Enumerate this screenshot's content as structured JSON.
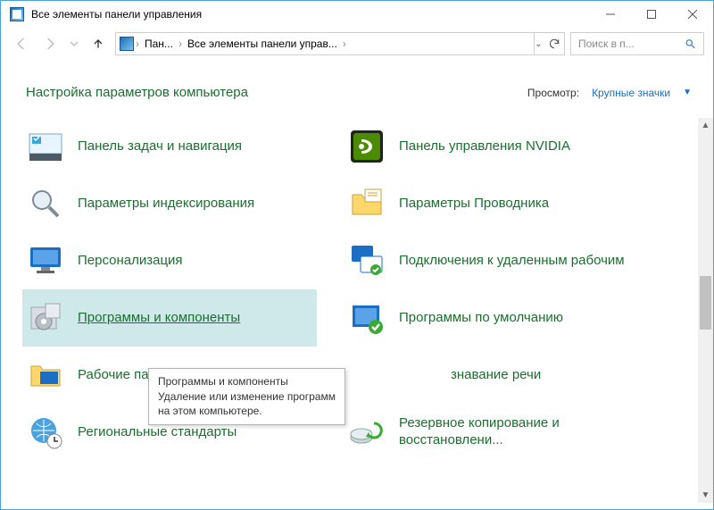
{
  "window": {
    "title": "Все элементы панели управления"
  },
  "breadcrumb": {
    "parts": [
      "Пан...",
      "Все элементы панели управ..."
    ]
  },
  "search": {
    "placeholder": "Поиск в п..."
  },
  "header": {
    "title": "Настройка параметров компьютера",
    "view_label": "Просмотр:",
    "view_value": "Крупные значки"
  },
  "items": [
    {
      "name": "taskbar-navigation",
      "label": "Панель задач и навигация"
    },
    {
      "name": "nvidia-panel",
      "label": "Панель управления NVIDIA"
    },
    {
      "name": "indexing-options",
      "label": "Параметры индексирования"
    },
    {
      "name": "explorer-options",
      "label": "Параметры Проводника"
    },
    {
      "name": "personalization",
      "label": "Персонализация"
    },
    {
      "name": "remote-desktop",
      "label": "Подключения к удаленным рабочим"
    },
    {
      "name": "programs-features",
      "label": "Программы и компоненты",
      "hovered": true
    },
    {
      "name": "default-programs",
      "label": "Программы по умолчанию"
    },
    {
      "name": "work-folders",
      "label": "Рабочие па"
    },
    {
      "name": "speech-recognition",
      "label": "знавание речи",
      "partial_left": true
    },
    {
      "name": "regional-settings",
      "label": "Региональные стандарты"
    },
    {
      "name": "backup-restore",
      "label": "Резервное копирование и восстановлени..."
    }
  ],
  "tooltip": {
    "title": "Программы и компоненты",
    "text1": "Удаление или изменение программ",
    "text2": "на этом компьютере."
  }
}
